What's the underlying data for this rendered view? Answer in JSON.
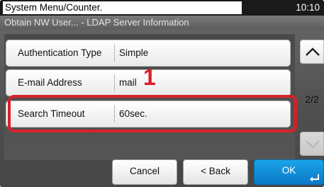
{
  "header": {
    "menu_title": "System Menu/Counter.",
    "clock": "10:10",
    "breadcrumb": "Obtain NW User... - LDAP Server Information"
  },
  "rows": [
    {
      "label": "Authentication Type",
      "value": "Simple"
    },
    {
      "label": "E-mail Address",
      "value": "mail"
    },
    {
      "label": "Search Timeout",
      "value": "60sec."
    }
  ],
  "annotation": {
    "callout": "1",
    "color": "#d9202a"
  },
  "pager": {
    "page": "2/2",
    "up_icon": "chevron-up-icon",
    "down_icon": "chevron-down-icon"
  },
  "buttons": {
    "cancel": "Cancel",
    "back": "< Back",
    "ok": "OK",
    "ok_icon": "enter-icon"
  },
  "colors": {
    "ok_button": "#1a8fdc",
    "highlight": "#d9202a",
    "title_bar": "#1a1a1a"
  }
}
